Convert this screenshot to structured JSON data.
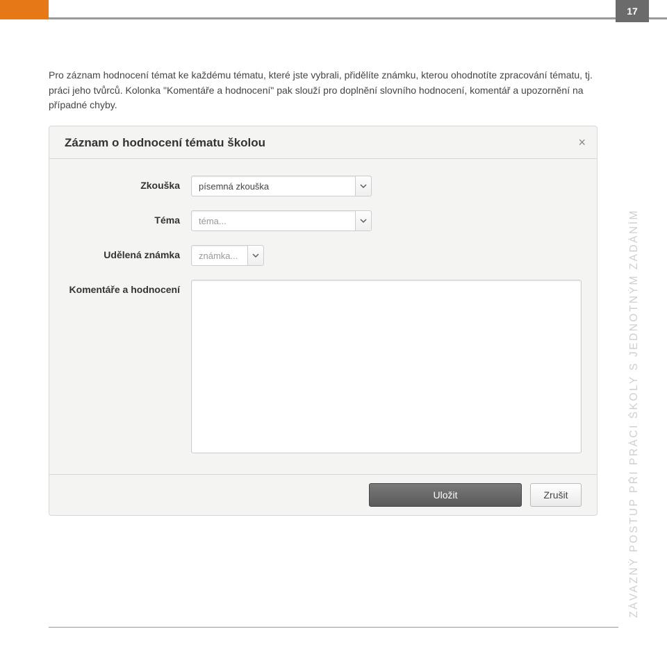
{
  "page_number": "17",
  "body_text": "Pro záznam hodnocení témat ke každému tématu, které jste vybrali, přidělíte známku, kterou ohodnotíte zpracování tématu, tj. práci jeho tvůrců. Kolonka \"Komentáře a hodnocení\" pak slouží pro doplnění slovního hodnocení, komentář a upozornění na případné chyby.",
  "side_text": "ZÁVAZNÝ POSTUP PŘI PRÁCI ŠKOLY S JEDNOTNÝM ZADÁNÍM",
  "form": {
    "title": "Záznam o hodnocení tématu školou",
    "fields": {
      "zkouska": {
        "label": "Zkouška",
        "value": "písemná zkouška"
      },
      "tema": {
        "label": "Téma",
        "placeholder": "téma..."
      },
      "znamka": {
        "label": "Udělená známka",
        "placeholder": "známka..."
      },
      "komentar": {
        "label": "Komentáře a hodnocení"
      }
    },
    "buttons": {
      "save": "Uložit",
      "cancel": "Zrušit"
    }
  }
}
